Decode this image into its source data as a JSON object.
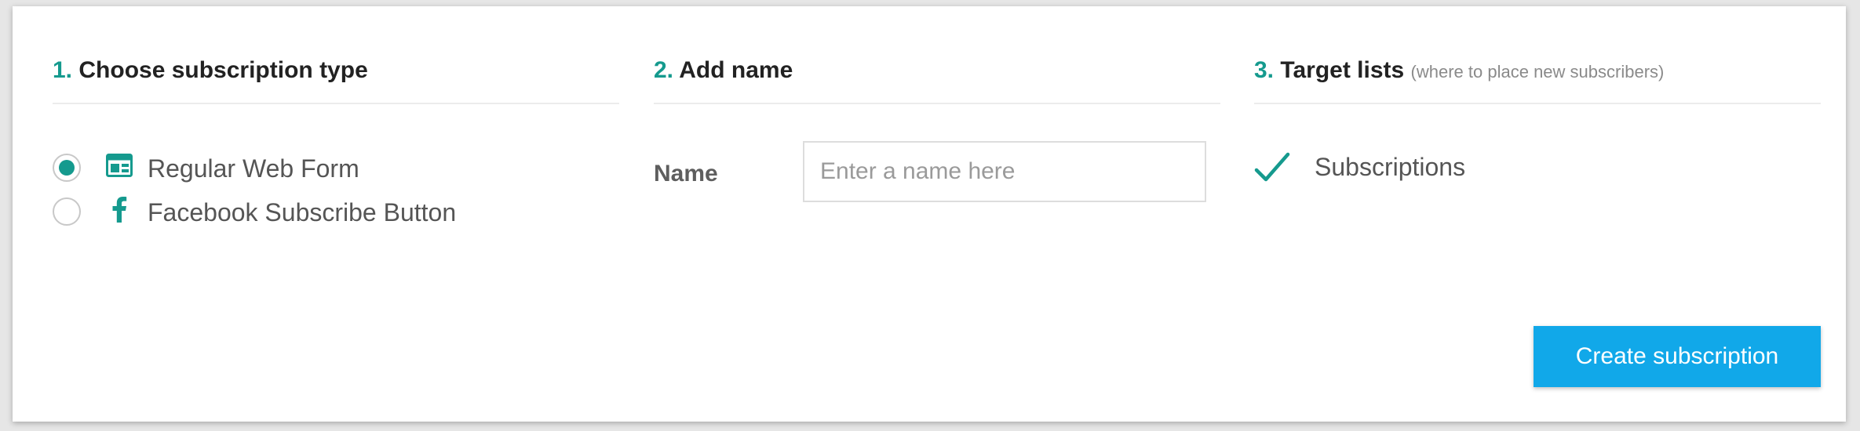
{
  "steps": {
    "subscription_type": {
      "number": "1.",
      "title": "Choose subscription type",
      "options": [
        {
          "label": "Regular Web Form",
          "icon": "web-form-icon",
          "selected": true
        },
        {
          "label": "Facebook Subscribe Button",
          "icon": "facebook-icon",
          "selected": false
        }
      ]
    },
    "add_name": {
      "number": "2.",
      "title": "Add name",
      "field_label": "Name",
      "input_value": "",
      "input_placeholder": "Enter a name here"
    },
    "target_lists": {
      "number": "3.",
      "title": "Target lists",
      "note": "(where to place new subscribers)",
      "lists": [
        {
          "label": "Subscriptions",
          "checked": true,
          "icon": "check-icon"
        }
      ]
    }
  },
  "actions": {
    "create_label": "Create subscription"
  },
  "colors": {
    "accent": "#159a8e",
    "primary_button": "#11a8e9",
    "text": "#555555",
    "heading": "#222222"
  }
}
